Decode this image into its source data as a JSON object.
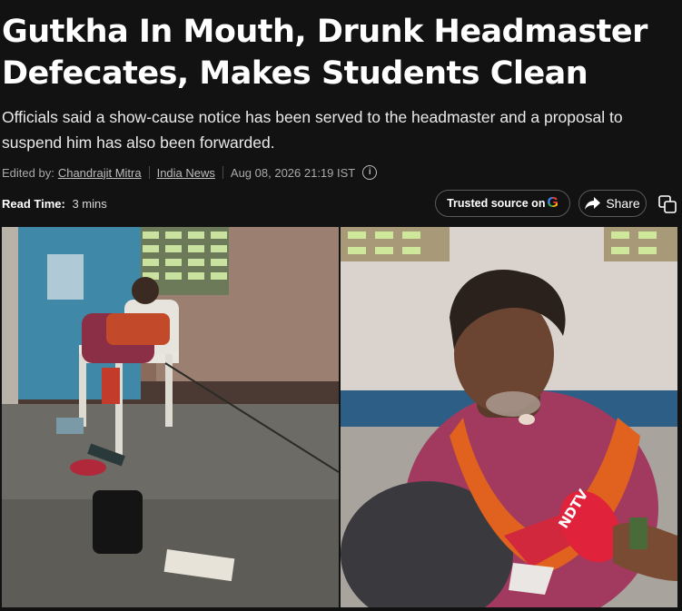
{
  "article": {
    "headline": "Gutkha In Mouth, Drunk Headmaster Defecates, Makes Students Clean",
    "summary": "Officials said a show-cause notice has been served to the headmaster and a proposal to suspend him has also been forwarded.",
    "meta": {
      "edited_by_label": "Edited by:",
      "editor": "Chandrajit Mitra",
      "category": "India News",
      "datetime": "Aug 08, 2026 21:19 IST"
    },
    "read_time_label": "Read Time:",
    "read_time_value": "3 mins"
  },
  "actions": {
    "trusted_source_label": "Trusted source on",
    "share_label": "Share"
  },
  "media": {
    "left_photo": "man-seated-on-chair-outside-blue-door",
    "right_photo": "man-speaking-into-ndtv-microphone",
    "mic_brand": "NDTV"
  },
  "colors": {
    "background": "#121212",
    "text": "#ffffff",
    "meta_text": "#a9a9a9",
    "pill_border": "#5a5a5a"
  }
}
